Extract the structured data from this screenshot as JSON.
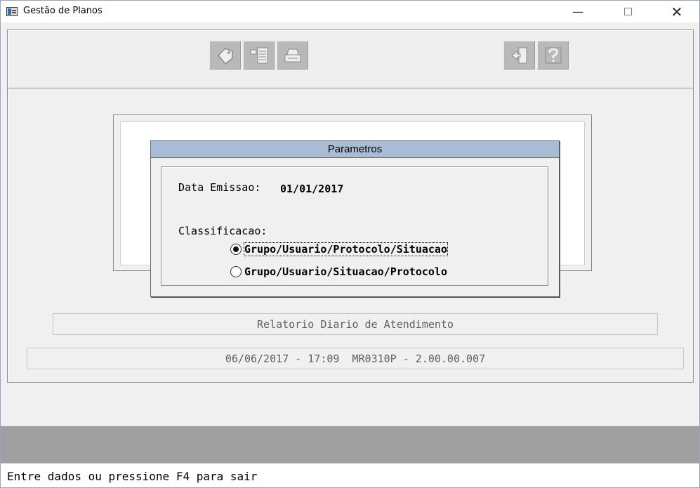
{
  "window": {
    "title": "Gestão de Planos",
    "minimize_glyph": "—",
    "close_glyph": "✕"
  },
  "toolbar": {
    "buttons": [
      {
        "icon": "tag-icon"
      },
      {
        "icon": "checklist-icon"
      },
      {
        "icon": "printer-icon"
      },
      {
        "icon": "exit-door-icon"
      },
      {
        "icon": "help-icon"
      }
    ]
  },
  "dialog": {
    "title": "Parametros",
    "data_emissao_label": "Data Emissao:",
    "data_emissao_value": "01/01/2017",
    "classificacao_label": "Classificacao:",
    "options": [
      {
        "label": "Grupo/Usuario/Protocolo/Situacao",
        "selected": true
      },
      {
        "label": "Grupo/Usuario/Situacao/Protocolo",
        "selected": false
      }
    ]
  },
  "report": {
    "title": "Relatorio Diario de Atendimento",
    "version_line": "06/06/2017 - 17:09  MR0310P - 2.00.00.007"
  },
  "status": {
    "message": "Entre dados ou pressione F4 para sair"
  },
  "colors": {
    "dialog_title_bg": "#a9bcd5",
    "gray_band": "#a0a0a0",
    "disabled_button": "#b9b9b9"
  }
}
